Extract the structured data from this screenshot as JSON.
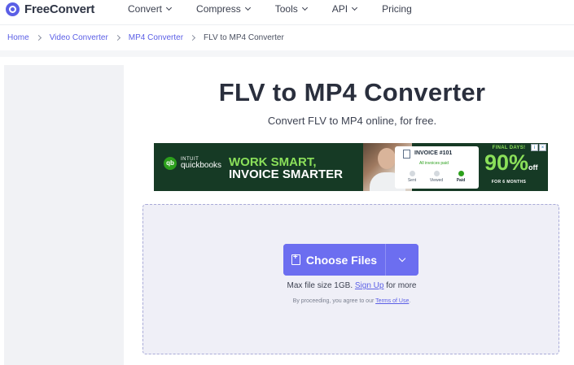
{
  "brand": {
    "name": "FreeConvert"
  },
  "nav": {
    "items": [
      {
        "label": "Convert"
      },
      {
        "label": "Compress"
      },
      {
        "label": "Tools"
      },
      {
        "label": "API"
      },
      {
        "label": "Pricing"
      }
    ]
  },
  "breadcrumb": {
    "items": [
      "Home",
      "Video Converter",
      "MP4 Converter"
    ],
    "current": "FLV to MP4 Converter"
  },
  "page": {
    "title": "FLV to MP4 Converter",
    "subtitle": "Convert FLV to MP4 online, for free."
  },
  "ad": {
    "brand_intuit": "INTUIT",
    "brand_name": "quickbooks",
    "headline_1": "WORK SMART,",
    "headline_2": "INVOICE SMARTER",
    "invoice_title": "INVOICE #101",
    "invoice_sub": "All invoices paid",
    "steps": [
      "Sent",
      "Viewed",
      "Paid"
    ],
    "promo_top": "FINAL DAYS!",
    "promo_pct": "90%",
    "promo_off": "off",
    "promo_bottom": "FOR 6 MONTHS",
    "accent_color": "#8be05a",
    "background_color": "#163a25"
  },
  "upload": {
    "button_label": "Choose Files",
    "max_text_pre": "Max file size 1GB.",
    "signup_label": "Sign Up",
    "max_text_post": "for more",
    "terms_pre": "By proceeding, you agree to our",
    "terms_link": "Terms of Use",
    "terms_post": ".",
    "accent_color": "#6c6ef0"
  }
}
